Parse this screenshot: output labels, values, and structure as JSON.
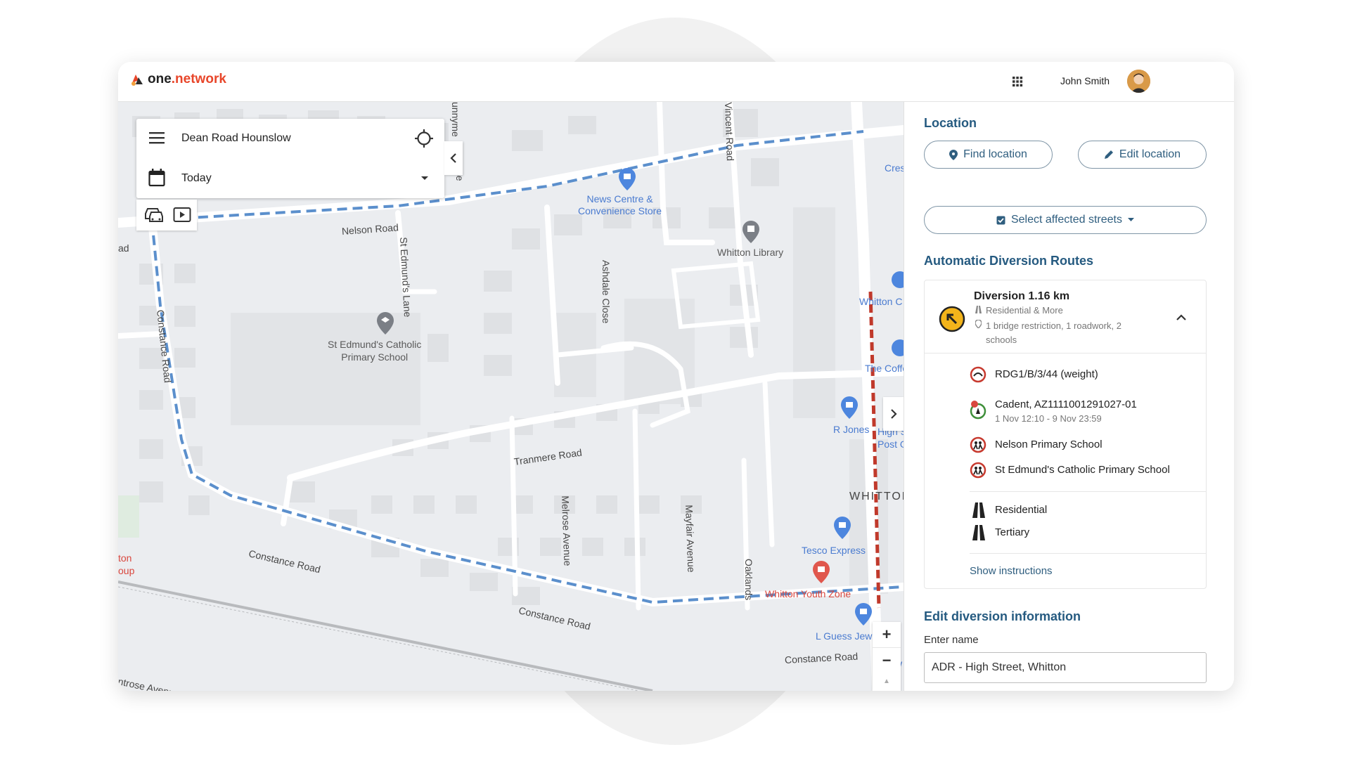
{
  "header": {
    "logo_one": "one",
    "logo_network": ".network",
    "user_name": "John Smith"
  },
  "search_panel": {
    "location": "Dean Road Hounslow",
    "date": "Today"
  },
  "map": {
    "roads": [
      "Nelson Road",
      "St Edmund's Lane",
      "Constance Road",
      "Constance Road",
      "Constance Road",
      "Constance Road",
      "Tranmere Road",
      "Ashdale Close",
      "Melrose Avenue",
      "Mayfair Avenue",
      "Oaklands",
      "Vincent Road",
      "unnyme",
      "ose",
      "ad",
      "ntrose Avenu"
    ],
    "pois": {
      "news_centre": "News Centre &\nConvenience Store",
      "library": "Whitton Library",
      "school": "St Edmund's Catholic\nPrimary School",
      "r_jones": "R Jones",
      "tesco": "Tesco Express",
      "youth_zone": "Whitton Youth Zone",
      "l_guess": "L Guess Jew",
      "whitton_c": "Whitton C",
      "coffee": "The Coffe",
      "high_st_post": "High S\nPost O",
      "crest": "Crest",
      "ton_oup": "ton\noup",
      "whitton_area": "WHITTON",
      "w": "W"
    },
    "zoom_in": "+",
    "zoom_out": "−",
    "colors": {
      "diversion": "#5b8fcc",
      "closure": "#c0392b"
    }
  },
  "side": {
    "location_heading": "Location",
    "find_location": "Find location",
    "edit_location": "Edit location",
    "select_streets": "Select affected streets",
    "auto_heading": "Automatic Diversion Routes",
    "diversion": {
      "title": "Diversion 1.16 km",
      "subtitle": "Residential & More",
      "details": "1 bridge restriction, 1 roadwork, 2 schools",
      "items": [
        {
          "icon": "weight-restriction-icon",
          "label": "RDG1/B/3/44 (weight)",
          "sub": ""
        },
        {
          "icon": "roadwork-icon",
          "label": "Cadent, AZ1111001291027-01",
          "sub": "1 Nov 12:10 - 9 Nov 23:59"
        },
        {
          "icon": "school-icon",
          "label": "Nelson Primary School",
          "sub": ""
        },
        {
          "icon": "school-icon",
          "label": "St Edmund's Catholic Primary School",
          "sub": ""
        }
      ],
      "road_types": [
        "Residential",
        "Tertiary"
      ],
      "show_instructions": "Show instructions"
    },
    "edit_heading": "Edit diversion information",
    "enter_name_label": "Enter name",
    "name_value": "ADR - High Street, Whitton"
  }
}
